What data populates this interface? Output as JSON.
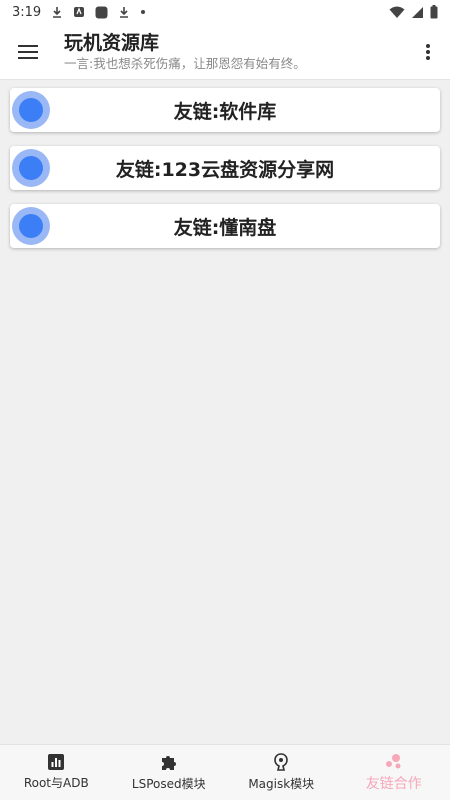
{
  "status_bar": {
    "time": "3:19"
  },
  "app_bar": {
    "title": "玩机资源库",
    "subtitle": "一言:我也想杀死伤痛，让那恩怨有始有终。"
  },
  "links": [
    {
      "label": "友链:软件库"
    },
    {
      "label": "友链:123云盘资源分享网"
    },
    {
      "label": "友链:懂南盘"
    }
  ],
  "bottom_nav": [
    {
      "label": "Root与ADB",
      "icon": "bar-chart-icon"
    },
    {
      "label": "LSPosed模块",
      "icon": "puzzle-icon"
    },
    {
      "label": "Magisk模块",
      "icon": "magisk-icon"
    },
    {
      "label": "友链合作",
      "icon": "bubbles-icon",
      "active": true
    }
  ],
  "colors": {
    "accent": "#3b7ef5",
    "accent_light": "#9ab8f5",
    "active_nav": "#f7a8b8"
  }
}
